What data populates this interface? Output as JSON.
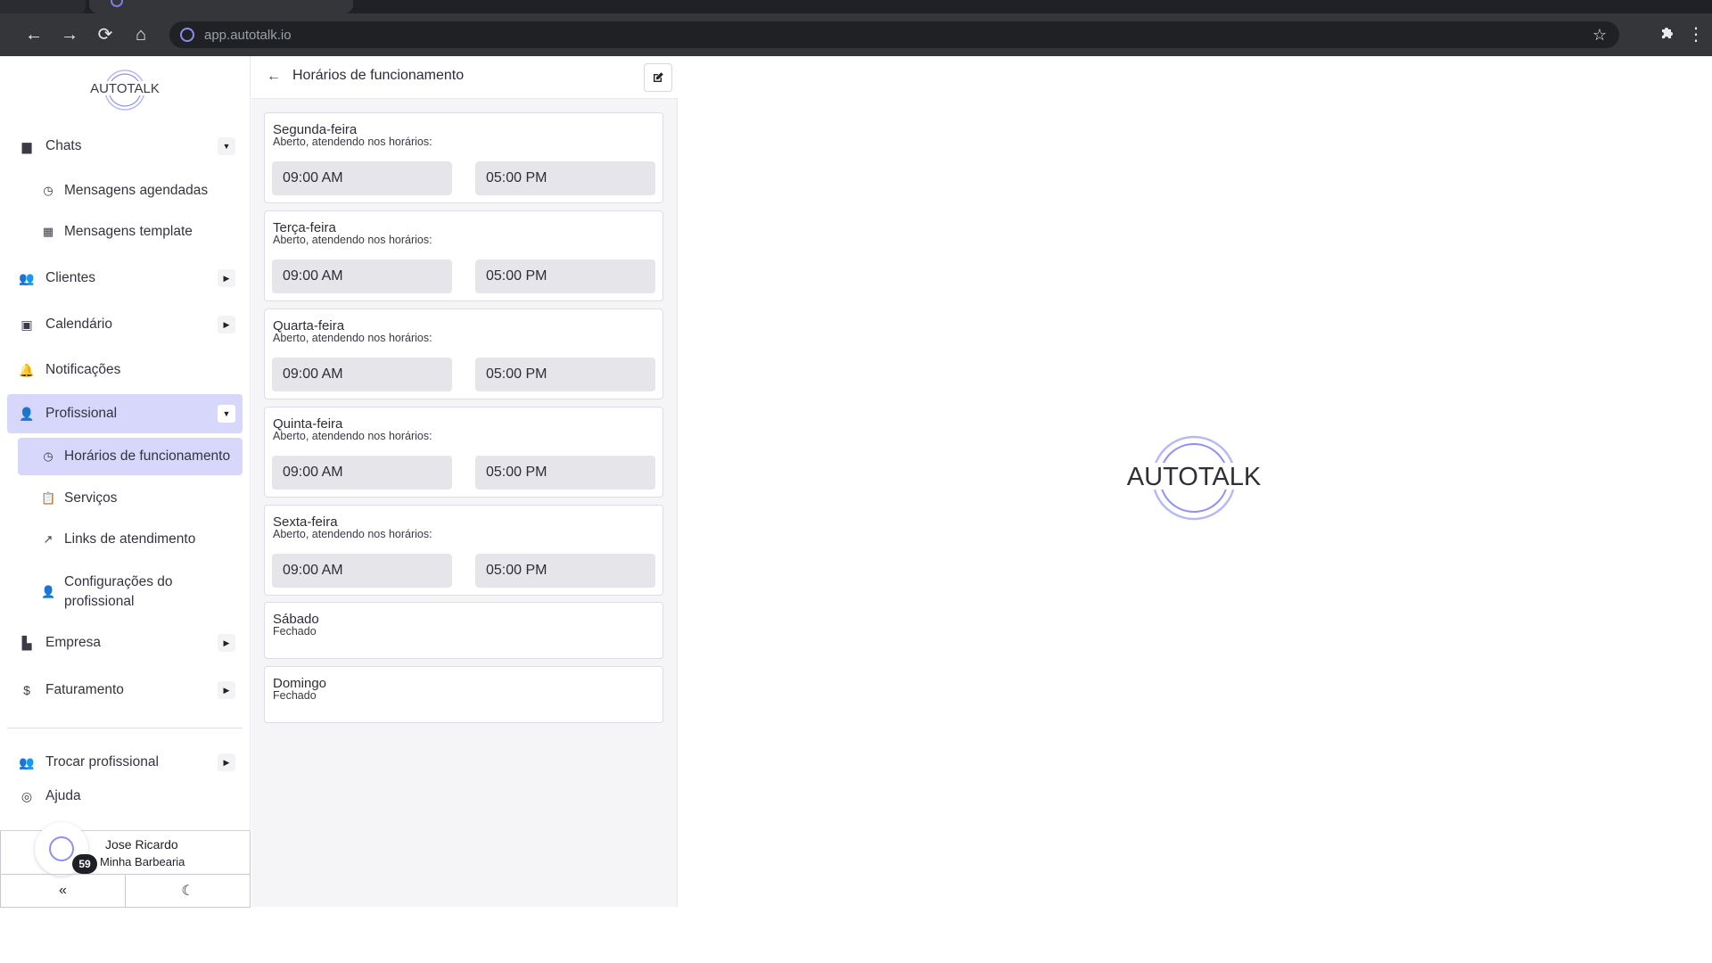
{
  "browser": {
    "url": "app.autotalk.io"
  },
  "brand": {
    "name": "AUTOTALK",
    "accent": "#8e90f2",
    "active_bg": "#d7d6fb"
  },
  "sidebar": {
    "items": {
      "chats": {
        "label": "Chats",
        "icon": "chat-bubble-icon"
      },
      "scheduled": {
        "label": "Mensagens agendadas",
        "icon": "clock-icon"
      },
      "template": {
        "label": "Mensagens template",
        "icon": "template-icon"
      },
      "clients": {
        "label": "Clientes",
        "icon": "users-icon"
      },
      "calendar": {
        "label": "Calendário",
        "icon": "calendar-icon"
      },
      "notifications": {
        "label": "Notificações",
        "icon": "bell-icon"
      },
      "professional": {
        "label": "Profissional",
        "icon": "user-gear-icon"
      },
      "hours": {
        "label": "Horários de funcionamento",
        "icon": "clock-icon"
      },
      "services": {
        "label": "Serviços",
        "icon": "clipboard-icon"
      },
      "links": {
        "label": "Links de atendimento",
        "icon": "external-link-icon"
      },
      "settings_line1": {
        "label": "Configurações do",
        "icon": "user-gear-icon"
      },
      "settings_line2": {
        "label": "profissional"
      },
      "company": {
        "label": "Empresa",
        "icon": "building-icon"
      },
      "billing": {
        "label": "Faturamento",
        "icon": "dollar-icon"
      },
      "switch": {
        "label": "Trocar profissional",
        "icon": "users-icon"
      },
      "help": {
        "label": "Ajuda",
        "icon": "help-icon"
      }
    },
    "user": {
      "name": "Jose Ricardo",
      "company": "Minha Barbearia",
      "badge": "59"
    }
  },
  "panel": {
    "title": "Horários de funcionamento",
    "days": [
      {
        "name": "Segunda-feira",
        "status": "Aberto, atendendo nos horários:",
        "open": "09:00 AM",
        "close": "05:00 PM"
      },
      {
        "name": "Terça-feira",
        "status": "Aberto, atendendo nos horários:",
        "open": "09:00 AM",
        "close": "05:00 PM"
      },
      {
        "name": "Quarta-feira",
        "status": "Aberto, atendendo nos horários:",
        "open": "09:00 AM",
        "close": "05:00 PM"
      },
      {
        "name": "Quinta-feira",
        "status": "Aberto, atendendo nos horários:",
        "open": "09:00 AM",
        "close": "05:00 PM"
      },
      {
        "name": "Sexta-feira",
        "status": "Aberto, atendendo nos horários:",
        "open": "09:00 AM",
        "close": "05:00 PM"
      },
      {
        "name": "Sábado",
        "status": "Fechado"
      },
      {
        "name": "Domingo",
        "status": "Fechado"
      }
    ]
  }
}
